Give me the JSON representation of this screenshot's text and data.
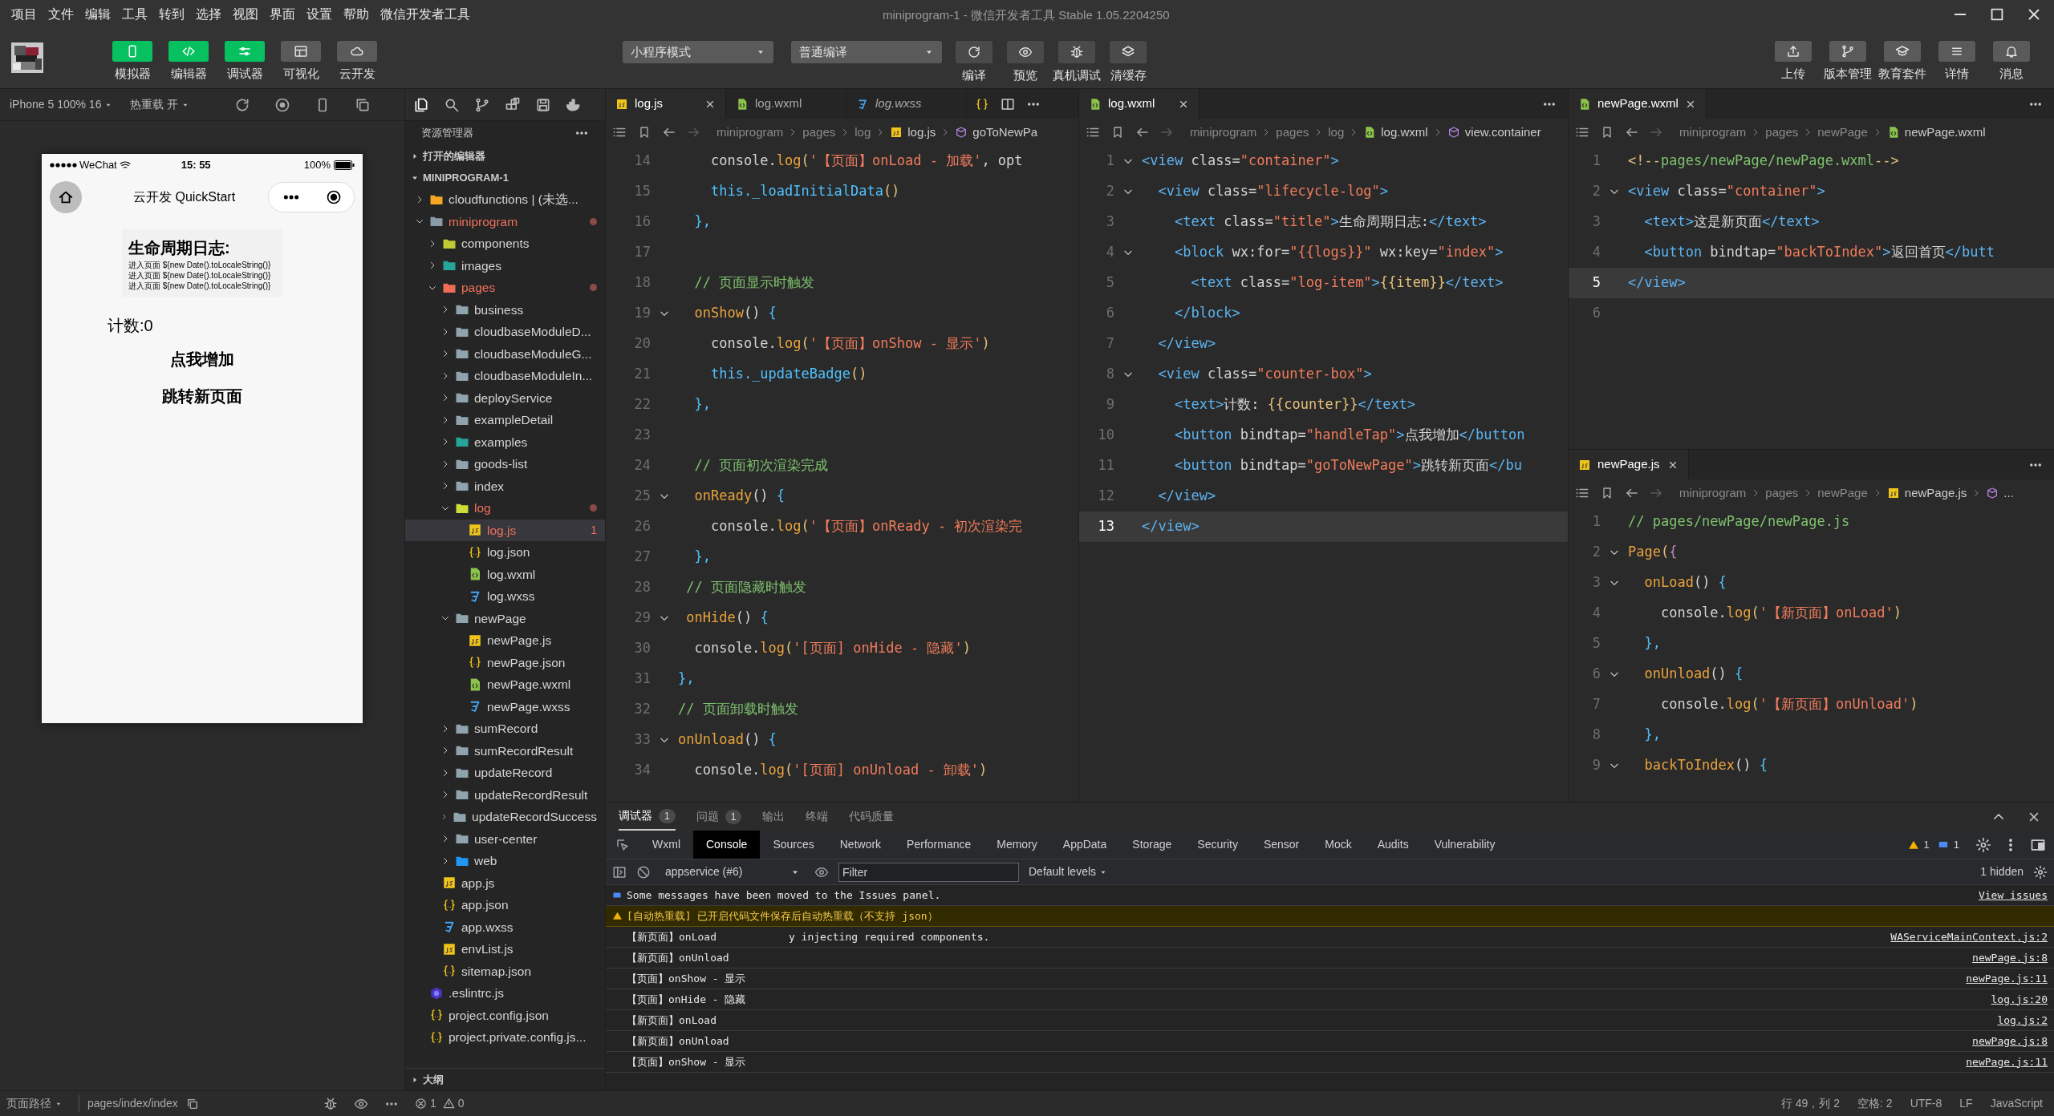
{
  "menu": [
    "项目",
    "文件",
    "编辑",
    "工具",
    "转到",
    "选择",
    "视图",
    "界面",
    "设置",
    "帮助",
    "微信开发者工具"
  ],
  "window": {
    "title": "miniprogram-1 - 微信开发者工具 Stable 1.05.2204250"
  },
  "toolbar": {
    "modes": [
      {
        "label": "模拟器",
        "selected": true
      },
      {
        "label": "编辑器",
        "selected": true
      },
      {
        "label": "调试器",
        "selected": true
      },
      {
        "label": "可视化",
        "selected": false
      },
      {
        "label": "云开发",
        "selected": false
      }
    ],
    "dropdowns": [
      "小程序模式",
      "普通编译"
    ],
    "actions": [
      "编译",
      "预览",
      "真机调试",
      "清缓存"
    ],
    "right_actions": [
      "上传",
      "版本管理",
      "教育套件",
      "详情",
      "消息"
    ]
  },
  "simulator": {
    "device": "iPhone 5 100% 16",
    "hot_reload": "热重载 开",
    "phone": {
      "carrier": "WeChat",
      "time": "15: 55",
      "battery": "100%",
      "nav_title": "云开发 QuickStart",
      "log_title": "生命周期日志:",
      "log_items": [
        "进入页面 ${new Date().toLocaleString()}",
        "进入页面 ${new Date().toLocaleString()}",
        "进入页面 ${new Date().toLocaleString()}"
      ],
      "counter": "计数:0",
      "buttons": [
        "点我增加",
        "跳转新页面"
      ]
    }
  },
  "explorer": {
    "title": "资源管理器",
    "sections": [
      {
        "label": "打开的编辑器",
        "expanded": false
      },
      {
        "label": "MINIPROGRAM-1",
        "expanded": true
      }
    ],
    "tree": [
      {
        "name": "cloudfunctions | (未选...",
        "kind": "folder",
        "color": "#f5a623",
        "expanded": false,
        "modified": false,
        "selected": false
      },
      {
        "name": "miniprogram",
        "kind": "folder",
        "color": "#8a9ba8",
        "expanded": true,
        "modified": true,
        "selected": false,
        "children": [
          {
            "name": "components",
            "kind": "folder",
            "color": "#c0ca33",
            "expanded": false,
            "modified": false,
            "selected": false
          },
          {
            "name": "images",
            "kind": "folder",
            "color": "#26a69a",
            "expanded": false,
            "modified": false,
            "selected": false
          },
          {
            "name": "pages",
            "kind": "folder",
            "color": "#ef6c57",
            "expanded": true,
            "modified": true,
            "selected": false,
            "children": [
              {
                "name": "business",
                "kind": "folder",
                "color": "#90a4ae",
                "expanded": false,
                "modified": false,
                "selected": false
              },
              {
                "name": "cloudbaseModuleD...",
                "kind": "folder",
                "color": "#90a4ae",
                "expanded": false,
                "modified": false,
                "selected": false
              },
              {
                "name": "cloudbaseModuleG...",
                "kind": "folder",
                "color": "#90a4ae",
                "expanded": false,
                "modified": false,
                "selected": false
              },
              {
                "name": "cloudbaseModuleIn...",
                "kind": "folder",
                "color": "#90a4ae",
                "expanded": false,
                "modified": false,
                "selected": false
              },
              {
                "name": "deployService",
                "kind": "folder",
                "color": "#90a4ae",
                "expanded": false,
                "modified": false,
                "selected": false
              },
              {
                "name": "exampleDetail",
                "kind": "folder",
                "color": "#90a4ae",
                "expanded": false,
                "modified": false,
                "selected": false
              },
              {
                "name": "examples",
                "kind": "folder",
                "color": "#26a69a",
                "expanded": false,
                "modified": false,
                "selected": false
              },
              {
                "name": "goods-list",
                "kind": "folder",
                "color": "#90a4ae",
                "expanded": false,
                "modified": false,
                "selected": false
              },
              {
                "name": "index",
                "kind": "folder",
                "color": "#90a4ae",
                "expanded": false,
                "modified": false,
                "selected": false
              },
              {
                "name": "log",
                "kind": "folder",
                "color": "#cddc39",
                "expanded": true,
                "modified": true,
                "selected": false,
                "children": [
                  {
                    "name": "log.js",
                    "kind": "js",
                    "modified": true,
                    "badge": "1",
                    "selected": true
                  },
                  {
                    "name": "log.json",
                    "kind": "json",
                    "modified": false,
                    "selected": false
                  },
                  {
                    "name": "log.wxml",
                    "kind": "wxml",
                    "modified": false,
                    "selected": false
                  },
                  {
                    "name": "log.wxss",
                    "kind": "wxss",
                    "modified": false,
                    "selected": false
                  }
                ]
              },
              {
                "name": "newPage",
                "kind": "folder",
                "color": "#90a4ae",
                "expanded": true,
                "modified": false,
                "selected": false,
                "children": [
                  {
                    "name": "newPage.js",
                    "kind": "js",
                    "modified": false,
                    "selected": false
                  },
                  {
                    "name": "newPage.json",
                    "kind": "json",
                    "modified": false,
                    "selected": false
                  },
                  {
                    "name": "newPage.wxml",
                    "kind": "wxml",
                    "modified": false,
                    "selected": false
                  },
                  {
                    "name": "newPage.wxss",
                    "kind": "wxss",
                    "modified": false,
                    "selected": false
                  }
                ]
              },
              {
                "name": "sumRecord",
                "kind": "folder",
                "color": "#90a4ae",
                "expanded": false,
                "modified": false,
                "selected": false
              },
              {
                "name": "sumRecordResult",
                "kind": "folder",
                "color": "#90a4ae",
                "expanded": false,
                "modified": false,
                "selected": false
              },
              {
                "name": "updateRecord",
                "kind": "folder",
                "color": "#90a4ae",
                "expanded": false,
                "modified": false,
                "selected": false
              },
              {
                "name": "updateRecordResult",
                "kind": "folder",
                "color": "#90a4ae",
                "expanded": false,
                "modified": false,
                "selected": false
              },
              {
                "name": "updateRecordSuccess",
                "kind": "folder",
                "color": "#90a4ae",
                "expanded": false,
                "modified": false,
                "selected": false
              },
              {
                "name": "user-center",
                "kind": "folder",
                "color": "#90a4ae",
                "expanded": false,
                "modified": false,
                "selected": false
              },
              {
                "name": "web",
                "kind": "folder",
                "color": "#2196f3",
                "expanded": false,
                "modified": false,
                "selected": false
              }
            ]
          },
          {
            "name": "app.js",
            "kind": "js",
            "modified": false,
            "selected": false
          },
          {
            "name": "app.json",
            "kind": "json",
            "modified": false,
            "selected": false
          },
          {
            "name": "app.wxss",
            "kind": "wxss",
            "modified": false,
            "selected": false
          },
          {
            "name": "envList.js",
            "kind": "js",
            "modified": false,
            "selected": false
          },
          {
            "name": "sitemap.json",
            "kind": "json",
            "modified": false,
            "selected": false
          }
        ]
      },
      {
        "name": ".eslintrc.js",
        "kind": "eslint",
        "modified": false,
        "selected": false
      },
      {
        "name": "project.config.json",
        "kind": "json",
        "modified": false,
        "selected": false
      },
      {
        "name": "project.private.config.js...",
        "kind": "json",
        "modified": false,
        "selected": false
      }
    ],
    "outline": {
      "label": "大纲",
      "expanded": false
    }
  },
  "editors": [
    {
      "tabs": [
        {
          "label": "log.js",
          "kind": "js",
          "selected": true,
          "preview": false
        },
        {
          "label": "log.wxml",
          "kind": "wxml",
          "selected": false,
          "preview": false
        },
        {
          "label": "log.wxss",
          "kind": "wxss",
          "selected": false,
          "preview": true
        }
      ],
      "breadcrumb": [
        {
          "text": "miniprogram",
          "kind": "folder"
        },
        {
          "text": "pages",
          "kind": "folder"
        },
        {
          "text": "log",
          "kind": "folder"
        },
        {
          "text": "log.js",
          "kind": "js"
        },
        {
          "text": "goToNewPa",
          "kind": "symbol"
        }
      ],
      "lines": [
        {
          "n": "14",
          "fold": false,
          "current": false,
          "tokens": [
            {
              "kind": "plain",
              "text": "    console."
            },
            {
              "kind": "fn",
              "text": "log"
            },
            {
              "kind": "brace",
              "text": "("
            },
            {
              "kind": "str",
              "text": "'【页面】onLoad - 加载'"
            },
            {
              "kind": "plain",
              "text": ", opt"
            }
          ]
        },
        {
          "n": "15",
          "fold": false,
          "current": false,
          "tokens": [
            {
              "kind": "kw",
              "text": "    this._loadInitialData"
            },
            {
              "kind": "brace",
              "text": "()"
            }
          ]
        },
        {
          "n": "16",
          "fold": false,
          "current": false,
          "tokens": [
            {
              "kind": "kw",
              "text": "  },"
            }
          ]
        },
        {
          "n": "17",
          "fold": false,
          "current": false
        },
        {
          "n": "18",
          "fold": false,
          "current": false,
          "tokens": [
            {
              "kind": "comment",
              "text": "  // 页面显示时触发"
            }
          ]
        },
        {
          "n": "19",
          "fold": true,
          "current": false,
          "tokens": [
            {
              "kind": "fn",
              "text": "  onShow"
            },
            {
              "kind": "plain",
              "text": "() "
            },
            {
              "kind": "kw",
              "text": "{"
            }
          ]
        },
        {
          "n": "20",
          "fold": false,
          "current": false,
          "tokens": [
            {
              "kind": "plain",
              "text": "    console."
            },
            {
              "kind": "fn",
              "text": "log"
            },
            {
              "kind": "brace",
              "text": "("
            },
            {
              "kind": "str",
              "text": "'【页面】onShow - 显示'"
            },
            {
              "kind": "brace",
              "text": ")"
            }
          ]
        },
        {
          "n": "21",
          "fold": false,
          "current": false,
          "tokens": [
            {
              "kind": "kw",
              "text": "    this._updateBadge"
            },
            {
              "kind": "brace",
              "text": "()"
            }
          ]
        },
        {
          "n": "22",
          "fold": false,
          "current": false,
          "tokens": [
            {
              "kind": "kw",
              "text": "  },"
            }
          ]
        },
        {
          "n": "23",
          "fold": false,
          "current": false
        },
        {
          "n": "24",
          "fold": false,
          "current": false,
          "tokens": [
            {
              "kind": "comment",
              "text": "  // 页面初次渲染完成"
            }
          ]
        },
        {
          "n": "25",
          "fold": true,
          "current": false,
          "tokens": [
            {
              "kind": "fn",
              "text": "  onReady"
            },
            {
              "kind": "plain",
              "text": "() "
            },
            {
              "kind": "kw",
              "text": "{"
            }
          ]
        },
        {
          "n": "26",
          "fold": false,
          "current": false,
          "tokens": [
            {
              "kind": "plain",
              "text": "    console."
            },
            {
              "kind": "fn",
              "text": "log"
            },
            {
              "kind": "brace",
              "text": "("
            },
            {
              "kind": "str",
              "text": "'【页面】onReady - 初次渲染完"
            }
          ]
        },
        {
          "n": "27",
          "fold": false,
          "current": false,
          "tokens": [
            {
              "kind": "kw",
              "text": "  },"
            }
          ]
        },
        {
          "n": "28",
          "fold": false,
          "current": false,
          "tokens": [
            {
              "kind": "comment",
              "text": " // 页面隐藏时触发"
            }
          ]
        },
        {
          "n": "29",
          "fold": true,
          "current": false,
          "tokens": [
            {
              "kind": "fn",
              "text": " onHide"
            },
            {
              "kind": "plain",
              "text": "() "
            },
            {
              "kind": "kw",
              "text": "{"
            }
          ]
        },
        {
          "n": "30",
          "fold": false,
          "current": false,
          "tokens": [
            {
              "kind": "plain",
              "text": "  console."
            },
            {
              "kind": "fn",
              "text": "log"
            },
            {
              "kind": "brace",
              "text": "("
            },
            {
              "kind": "str",
              "text": "'[页面] onHide - 隐藏'"
            },
            {
              "kind": "brace",
              "text": ")"
            }
          ]
        },
        {
          "n": "31",
          "fold": false,
          "current": false,
          "tokens": [
            {
              "kind": "kw",
              "text": "},"
            }
          ]
        },
        {
          "n": "32",
          "fold": false,
          "current": false,
          "tokens": [
            {
              "kind": "comment",
              "text": "// 页面卸载时触发"
            }
          ]
        },
        {
          "n": "33",
          "fold": true,
          "current": false,
          "tokens": [
            {
              "kind": "fn",
              "text": "onUnload"
            },
            {
              "kind": "plain",
              "text": "() "
            },
            {
              "kind": "kw",
              "text": "{"
            }
          ]
        },
        {
          "n": "34",
          "fold": false,
          "current": false,
          "tokens": [
            {
              "kind": "plain",
              "text": "  console."
            },
            {
              "kind": "fn",
              "text": "log"
            },
            {
              "kind": "brace",
              "text": "("
            },
            {
              "kind": "str",
              "text": "'[页面] onUnload - 卸载'"
            },
            {
              "kind": "brace",
              "text": ")"
            }
          ]
        }
      ]
    },
    {
      "tabs": [
        {
          "label": "log.wxml",
          "kind": "wxml",
          "selected": true,
          "preview": false
        }
      ],
      "breadcrumb": [
        {
          "text": "miniprogram",
          "kind": "folder"
        },
        {
          "text": "pages",
          "kind": "folder"
        },
        {
          "text": "log",
          "kind": "folder"
        },
        {
          "text": "log.wxml",
          "kind": "wxml"
        },
        {
          "text": "view.container",
          "kind": "symbol"
        }
      ],
      "lines": [
        {
          "n": "1",
          "fold": true,
          "current": false,
          "tokens": [
            {
              "kind": "tag",
              "text": "<view "
            },
            {
              "kind": "plain",
              "text": "class="
            },
            {
              "kind": "str",
              "text": "\"container\""
            },
            {
              "kind": "tag",
              "text": ">"
            }
          ]
        },
        {
          "n": "2",
          "fold": true,
          "current": false,
          "tokens": [
            {
              "kind": "tag",
              "text": "  <view "
            },
            {
              "kind": "plain",
              "text": "class="
            },
            {
              "kind": "str",
              "text": "\"lifecycle-log\""
            },
            {
              "kind": "tag",
              "text": ">"
            }
          ]
        },
        {
          "n": "3",
          "fold": false,
          "current": false,
          "tokens": [
            {
              "kind": "tag",
              "text": "    <text "
            },
            {
              "kind": "plain",
              "text": "class="
            },
            {
              "kind": "str",
              "text": "\"title\""
            },
            {
              "kind": "tag",
              "text": ">"
            },
            {
              "kind": "plain",
              "text": "生命周期日志:"
            },
            {
              "kind": "tag",
              "text": "</text>"
            }
          ]
        },
        {
          "n": "4",
          "fold": true,
          "current": false,
          "tokens": [
            {
              "kind": "tag",
              "text": "    <block "
            },
            {
              "kind": "plain",
              "text": "wx:for="
            },
            {
              "kind": "str",
              "text": "\"{{logs}}\""
            },
            {
              "kind": "plain",
              "text": " wx:key="
            },
            {
              "kind": "str",
              "text": "\"index\""
            },
            {
              "kind": "tag",
              "text": ">"
            }
          ]
        },
        {
          "n": "5",
          "fold": false,
          "current": false,
          "tokens": [
            {
              "kind": "tag",
              "text": "      <text "
            },
            {
              "kind": "plain",
              "text": "class="
            },
            {
              "kind": "str",
              "text": "\"log-item\""
            },
            {
              "kind": "tag",
              "text": ">"
            },
            {
              "kind": "brace",
              "text": "{{item}}"
            },
            {
              "kind": "tag",
              "text": "</text>"
            }
          ]
        },
        {
          "n": "6",
          "fold": false,
          "current": false,
          "tokens": [
            {
              "kind": "tag",
              "text": "    </block>"
            }
          ]
        },
        {
          "n": "7",
          "fold": false,
          "current": false,
          "tokens": [
            {
              "kind": "tag",
              "text": "  </view>"
            }
          ]
        },
        {
          "n": "8",
          "fold": true,
          "current": false,
          "tokens": [
            {
              "kind": "tag",
              "text": "  <view "
            },
            {
              "kind": "plain",
              "text": "class="
            },
            {
              "kind": "str",
              "text": "\"counter-box\""
            },
            {
              "kind": "tag",
              "text": ">"
            }
          ]
        },
        {
          "n": "9",
          "fold": false,
          "current": false,
          "tokens": [
            {
              "kind": "tag",
              "text": "    <text>"
            },
            {
              "kind": "plain",
              "text": "计数: "
            },
            {
              "kind": "brace",
              "text": "{{counter}}"
            },
            {
              "kind": "tag",
              "text": "</text>"
            }
          ]
        },
        {
          "n": "10",
          "fold": false,
          "current": false,
          "tokens": [
            {
              "kind": "tag",
              "text": "    <button "
            },
            {
              "kind": "plain",
              "text": "bindtap="
            },
            {
              "kind": "str",
              "text": "\"handleTap\""
            },
            {
              "kind": "tag",
              "text": ">"
            },
            {
              "kind": "plain",
              "text": "点我增加"
            },
            {
              "kind": "tag",
              "text": "</button"
            }
          ]
        },
        {
          "n": "11",
          "fold": false,
          "current": false,
          "tokens": [
            {
              "kind": "tag",
              "text": "    <button "
            },
            {
              "kind": "plain",
              "text": "bindtap="
            },
            {
              "kind": "str",
              "text": "\"goToNewPage\""
            },
            {
              "kind": "tag",
              "text": ">"
            },
            {
              "kind": "plain",
              "text": "跳转新页面"
            },
            {
              "kind": "tag",
              "text": "</bu"
            }
          ]
        },
        {
          "n": "12",
          "fold": false,
          "current": false,
          "tokens": [
            {
              "kind": "tag",
              "text": "  </view>"
            }
          ]
        },
        {
          "n": "13",
          "fold": false,
          "current": true,
          "tokens": [
            {
              "kind": "tag",
              "text": "</view>"
            }
          ]
        }
      ]
    },
    {
      "tabs": [
        {
          "label": "newPage.wxml",
          "kind": "wxml",
          "selected": true,
          "preview": false
        }
      ],
      "breadcrumb": [
        {
          "text": "miniprogram",
          "kind": "folder"
        },
        {
          "text": "pages",
          "kind": "folder"
        },
        {
          "text": "newPage",
          "kind": "folder"
        },
        {
          "text": "newPage.wxml",
          "kind": "wxml"
        }
      ],
      "lines": [
        {
          "n": "1",
          "fold": false,
          "current": false,
          "tokens": [
            {
              "kind": "brace",
              "text": "<!--"
            },
            {
              "kind": "comment",
              "text": "pages/newPage/newPage.wxml"
            },
            {
              "kind": "brace",
              "text": "-->"
            }
          ]
        },
        {
          "n": "2",
          "fold": true,
          "current": false,
          "tokens": [
            {
              "kind": "tag",
              "text": "<view "
            },
            {
              "kind": "plain",
              "text": "class="
            },
            {
              "kind": "str",
              "text": "\"container\""
            },
            {
              "kind": "tag",
              "text": ">"
            }
          ]
        },
        {
          "n": "3",
          "fold": false,
          "current": false,
          "tokens": [
            {
              "kind": "tag",
              "text": "  <text>"
            },
            {
              "kind": "plain",
              "text": "这是新页面"
            },
            {
              "kind": "tag",
              "text": "</text>"
            }
          ]
        },
        {
          "n": "4",
          "fold": false,
          "current": false,
          "tokens": [
            {
              "kind": "tag",
              "text": "  <button "
            },
            {
              "kind": "plain",
              "text": "bindtap="
            },
            {
              "kind": "str",
              "text": "\"backToIndex\""
            },
            {
              "kind": "tag",
              "text": ">"
            },
            {
              "kind": "plain",
              "text": "返回首页"
            },
            {
              "kind": "tag",
              "text": "</butt"
            }
          ]
        },
        {
          "n": "5",
          "fold": false,
          "current": true,
          "tokens": [
            {
              "kind": "tag",
              "text": "</view>"
            }
          ]
        },
        {
          "n": "6",
          "fold": false,
          "current": false
        }
      ]
    },
    {
      "tabs": [
        {
          "label": "newPage.js",
          "kind": "js",
          "selected": true,
          "preview": false
        }
      ],
      "breadcrumb": [
        {
          "text": "miniprogram",
          "kind": "folder"
        },
        {
          "text": "pages",
          "kind": "folder"
        },
        {
          "text": "newPage",
          "kind": "folder"
        },
        {
          "text": "newPage.js",
          "kind": "js"
        },
        {
          "text": "...",
          "kind": "symbol"
        }
      ],
      "lines": [
        {
          "n": "1",
          "fold": false,
          "current": false,
          "tokens": [
            {
              "kind": "comment",
              "text": "// pages/newPage/newPage.js"
            }
          ]
        },
        {
          "n": "2",
          "fold": true,
          "current": false,
          "tokens": [
            {
              "kind": "fn",
              "text": "Page"
            },
            {
              "kind": "brace",
              "text": "("
            },
            {
              "kind": "magenta",
              "text": "{"
            }
          ]
        },
        {
          "n": "3",
          "fold": true,
          "current": false,
          "tokens": [
            {
              "kind": "fn",
              "text": "  onLoad"
            },
            {
              "kind": "plain",
              "text": "() "
            },
            {
              "kind": "kw",
              "text": "{"
            }
          ]
        },
        {
          "n": "4",
          "fold": false,
          "current": false,
          "tokens": [
            {
              "kind": "plain",
              "text": "    console."
            },
            {
              "kind": "fn",
              "text": "log"
            },
            {
              "kind": "brace",
              "text": "("
            },
            {
              "kind": "str",
              "text": "'【新页面】onLoad'"
            },
            {
              "kind": "brace",
              "text": ")"
            }
          ]
        },
        {
          "n": "5",
          "fold": false,
          "current": false,
          "tokens": [
            {
              "kind": "kw",
              "text": "  },"
            }
          ]
        },
        {
          "n": "6",
          "fold": true,
          "current": false,
          "tokens": [
            {
              "kind": "fn",
              "text": "  onUnload"
            },
            {
              "kind": "plain",
              "text": "() "
            },
            {
              "kind": "kw",
              "text": "{"
            }
          ]
        },
        {
          "n": "7",
          "fold": false,
          "current": false,
          "tokens": [
            {
              "kind": "plain",
              "text": "    console."
            },
            {
              "kind": "fn",
              "text": "log"
            },
            {
              "kind": "brace",
              "text": "("
            },
            {
              "kind": "str",
              "text": "'【新页面】onUnload'"
            },
            {
              "kind": "brace",
              "text": ")"
            }
          ]
        },
        {
          "n": "8",
          "fold": false,
          "current": false,
          "tokens": [
            {
              "kind": "kw",
              "text": "  },"
            }
          ]
        },
        {
          "n": "9",
          "fold": true,
          "current": false,
          "tokens": [
            {
              "kind": "fn",
              "text": "  backToIndex"
            },
            {
              "kind": "plain",
              "text": "() "
            },
            {
              "kind": "kw",
              "text": "{"
            }
          ]
        }
      ]
    }
  ],
  "console": {
    "panel_tabs": [
      {
        "label": "调试器",
        "badge": "1",
        "selected": true
      },
      {
        "label": "问题",
        "badge": "1",
        "selected": false
      },
      {
        "label": "输出",
        "selected": false
      },
      {
        "label": "终端",
        "selected": false
      },
      {
        "label": "代码质量",
        "selected": false
      }
    ],
    "devtools_tabs": [
      {
        "label": "Wxml",
        "selected": false
      },
      {
        "label": "Console",
        "selected": true
      },
      {
        "label": "Sources",
        "selected": false
      },
      {
        "label": "Network",
        "selected": false
      },
      {
        "label": "Performance",
        "selected": false
      },
      {
        "label": "Memory",
        "selected": false
      },
      {
        "label": "AppData",
        "selected": false
      },
      {
        "label": "Storage",
        "selected": false
      },
      {
        "label": "Security",
        "selected": false
      },
      {
        "label": "Sensor",
        "selected": false
      },
      {
        "label": "Mock",
        "selected": false
      },
      {
        "label": "Audits",
        "selected": false
      },
      {
        "label": "Vulnerability",
        "selected": false
      }
    ],
    "warning_count": "1",
    "info_count": "1",
    "context": "appservice (#6)",
    "filter": {
      "placeholder": "Filter"
    },
    "levels": "Default levels",
    "hidden": "1 hidden",
    "messages": [
      {
        "kind": "info",
        "text": "Some messages have been moved to the Issues panel.",
        "link": "View issues"
      },
      {
        "kind": "warning",
        "text": "[自动热重载] 已开启代码文件保存后自动热重载（不支持 json）"
      },
      {
        "kind": "log",
        "text": "【新页面】onLoad",
        "extra": "y injecting required components.",
        "link": "WAServiceMainContext.js:2"
      },
      {
        "kind": "log",
        "text": "【新页面】onUnload",
        "link": "newPage.js:8"
      },
      {
        "kind": "log",
        "text": "【页面】onShow - 显示",
        "link": "newPage.js:11"
      },
      {
        "kind": "log",
        "text": "【页面】onHide - 隐藏",
        "link": "log.js:20"
      },
      {
        "kind": "log",
        "text": "【新页面】onLoad",
        "link": "log.js:2"
      },
      {
        "kind": "log",
        "text": "【新页面】onUnload",
        "link": "newPage.js:8"
      },
      {
        "kind": "log",
        "text": "【页面】onShow - 显示",
        "link": "newPage.js:11"
      }
    ]
  },
  "status_bar": {
    "page_path": "页面路径",
    "path": "pages/index/index",
    "errors": "1",
    "warnings": "0",
    "position": "行 49，列 2",
    "spaces": "空格: 2",
    "encoding": "UTF-8",
    "eol": "LF",
    "language": "JavaScript"
  }
}
